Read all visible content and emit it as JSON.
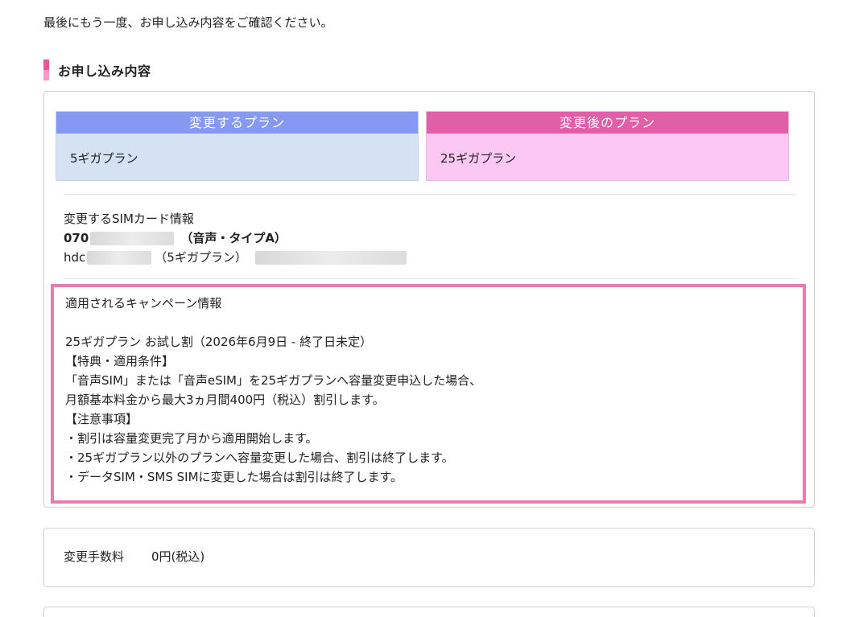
{
  "intro": "最後にもう一度、お申し込み内容をご確認ください。",
  "section_title": "お申し込み内容",
  "plans": {
    "before_header": "変更するプラン",
    "before_name": "5ギガプラン",
    "after_header": "変更後のプラン",
    "after_name": "25ギガプラン"
  },
  "sim": {
    "title": "変更するSIMカード情報",
    "number_prefix": "070",
    "number_type": "（音声・タイプA）",
    "account_prefix": "hdc",
    "account_plan": "（5ギガプラン）"
  },
  "campaign": {
    "title": "適用されるキャンペーン情報",
    "name": "25ギガプラン お試し割（2026年6月9日 - 終了日未定）",
    "benefit_heading": "【特典・適用条件】",
    "benefit_line1": "「音声SIM」または「音声eSIM」を25ギガプランへ容量変更申込した場合、",
    "benefit_line2": "月額基本料金から最大3ヵ月間400円（税込）割引します。",
    "notes_heading": "【注意事項】",
    "note1": "・割引は容量変更完了月から適用開始します。",
    "note2": "・25ギガプラン以外のプランへ容量変更した場合、割引は終了します。",
    "note3": "・データSIM・SMS SIMに変更した場合は割引は終了します。"
  },
  "fee": {
    "label": "変更手数料",
    "value": "0円(税込)"
  },
  "colors": {
    "accent_pink": "#e05fa6",
    "accent_blue": "#8598f2",
    "campaign_border": "#ee78b0"
  }
}
